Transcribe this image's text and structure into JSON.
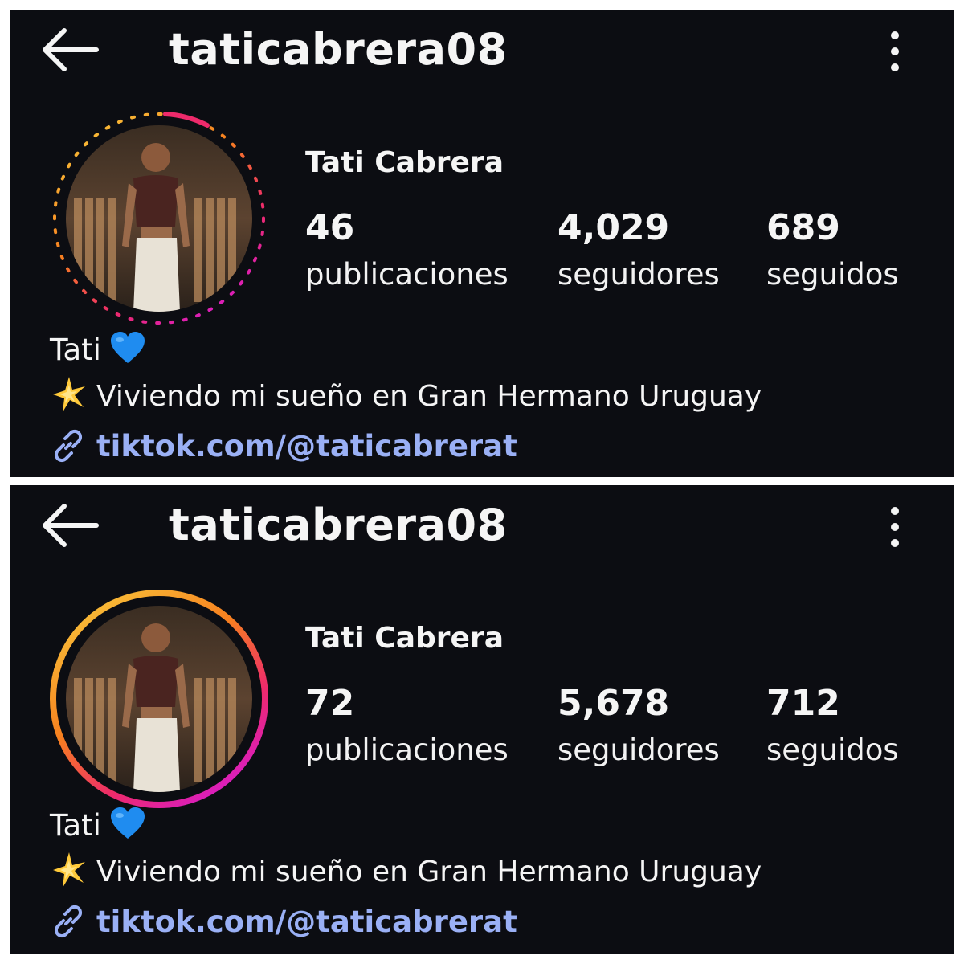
{
  "colors": {
    "background": "#0c0d12",
    "text": "#f5f5f5",
    "link": "#9ab0f5",
    "ring_gradient": [
      "#f9c43a",
      "#f7801f",
      "#ee2a6b",
      "#d41ad6"
    ],
    "heart": "#1f8cf0"
  },
  "profiles": [
    {
      "header": {
        "username": "taticabrera08",
        "back_icon": "arrow-left-icon",
        "menu_icon": "kebab-menu-icon"
      },
      "avatar": {
        "ring_style": "dashed-story-ring",
        "image": "profile-photo"
      },
      "display_name": "Tati Cabrera",
      "stats": {
        "posts": {
          "value": "46",
          "label": "publicaciones"
        },
        "followers": {
          "value": "4,029",
          "label": "seguidores"
        },
        "following": {
          "value": "689",
          "label": "seguidos"
        }
      },
      "bio": {
        "name": "Tati",
        "name_icon": "blue-heart-icon",
        "text": "Viviendo mi sueño en Gran Hermano Uruguay",
        "text_icon": "sparkle-star-icon",
        "link": "tiktok.com/@taticabrerat",
        "link_icon": "link-icon"
      }
    },
    {
      "header": {
        "username": "taticabrera08",
        "back_icon": "arrow-left-icon",
        "menu_icon": "kebab-menu-icon"
      },
      "avatar": {
        "ring_style": "solid-story-ring",
        "image": "profile-photo"
      },
      "display_name": "Tati Cabrera",
      "stats": {
        "posts": {
          "value": "72",
          "label": "publicaciones"
        },
        "followers": {
          "value": "5,678",
          "label": "seguidores"
        },
        "following": {
          "value": "712",
          "label": "seguidos"
        }
      },
      "bio": {
        "name": "Tati",
        "name_icon": "blue-heart-icon",
        "text": "Viviendo mi sueño en Gran Hermano Uruguay",
        "text_icon": "sparkle-star-icon",
        "link": "tiktok.com/@taticabrerat",
        "link_icon": "link-icon"
      }
    }
  ]
}
